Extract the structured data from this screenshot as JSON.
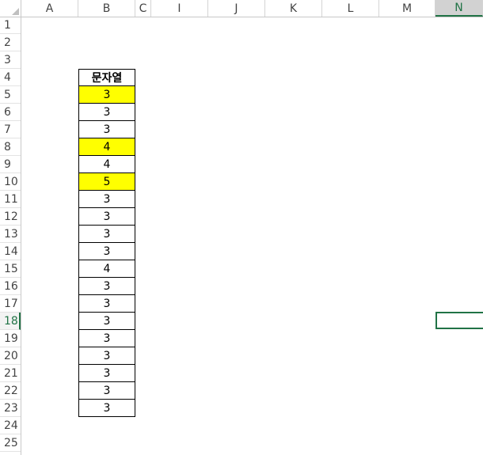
{
  "columns": [
    "A",
    "B",
    "C",
    "I",
    "J",
    "K",
    "L",
    "M",
    "N"
  ],
  "active_column": "N",
  "rows": [
    "1",
    "2",
    "3",
    "4",
    "5",
    "6",
    "7",
    "8",
    "9",
    "10",
    "11",
    "12",
    "13",
    "14",
    "15",
    "16",
    "17",
    "18",
    "19",
    "20",
    "21",
    "22",
    "23",
    "24",
    "25"
  ],
  "active_row": "18",
  "table": {
    "header": "문자열",
    "values": [
      "3",
      "3",
      "3",
      "4",
      "4",
      "5",
      "3",
      "3",
      "3",
      "3",
      "4",
      "3",
      "3",
      "3",
      "3",
      "3",
      "3",
      "3",
      "3"
    ],
    "highlighted_rows": [
      0,
      3,
      5
    ],
    "highlight_color": "#ffff00"
  },
  "accent_color": "#217346"
}
